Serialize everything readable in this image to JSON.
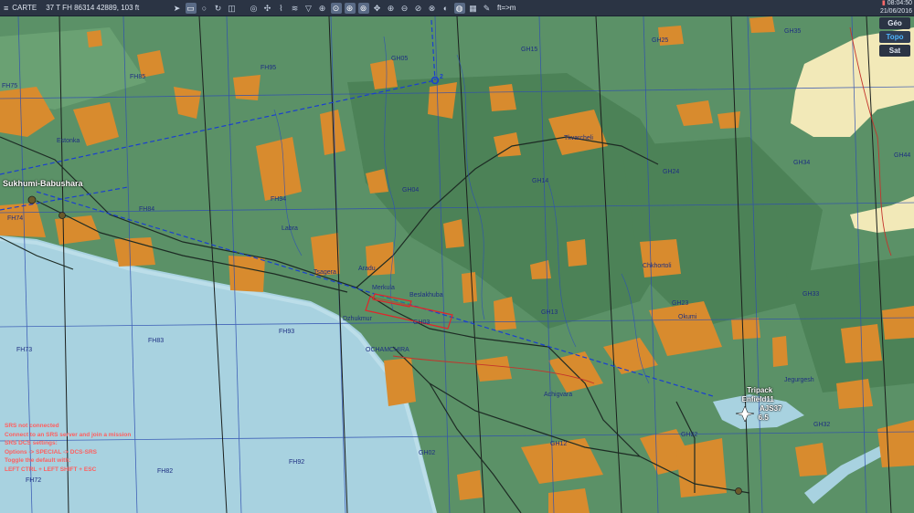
{
  "topbar": {
    "menu_label": "CARTE",
    "coordinates": "37 T FH 86314 42889, 103 ft",
    "units_toggle": "ft=>m",
    "time": "08:04:50",
    "date": "21/06/2016"
  },
  "layers": {
    "geo": "Géo",
    "topo": "Topo",
    "sat": "Sat",
    "active": "Topo"
  },
  "airfield": {
    "name": "Sukhumi-Babushara"
  },
  "unit": {
    "group": "Tripack",
    "callsign": "Enfield11",
    "type": "AJS37",
    "value": "6.5"
  },
  "places": [
    "Estonka",
    "Labra",
    "Tkvarcheli",
    "Tsagera",
    "Aradu",
    "Merkula",
    "Beslakhuba",
    "Dzhukmur",
    "OCHAMCHIRA",
    "Chkhortoli",
    "Okumi",
    "Achigvara",
    "Jegurgesh"
  ],
  "grid_labels": [
    "FH75",
    "FH85",
    "FH95",
    "GH05",
    "GH15",
    "GH25",
    "GH35",
    "FH74",
    "FH84",
    "FH94",
    "GH04",
    "GH14",
    "GH24",
    "GH34",
    "GH44",
    "FH73",
    "FH83",
    "FH93",
    "GH03",
    "GH13",
    "GH23",
    "GH33",
    "FH72",
    "FH82",
    "FH92",
    "GH02",
    "GH12",
    "GH22",
    "GH32"
  ],
  "waypoint": {
    "number": "2"
  },
  "srs_notice": [
    "SRS not connected",
    "Connect to an SRS server and join a mission",
    "SRS DCS settings:",
    "Options -> SPECIAL -> DCS-SRS",
    "Toggle the default with:",
    "LEFT CTRL + LEFT SHIFT + ESC"
  ],
  "colors": {
    "land": "#5b9167",
    "land_dark": "#4a7f59",
    "forest": "#4c8257",
    "urban": "#d88b2e",
    "sea": "#a8d2e0",
    "mountain": "#f2e9b8",
    "route": "#1a3fd0",
    "roads": "#1d2b24",
    "grid_blue": "#2f4fb0",
    "topbar": "#2b3444"
  }
}
